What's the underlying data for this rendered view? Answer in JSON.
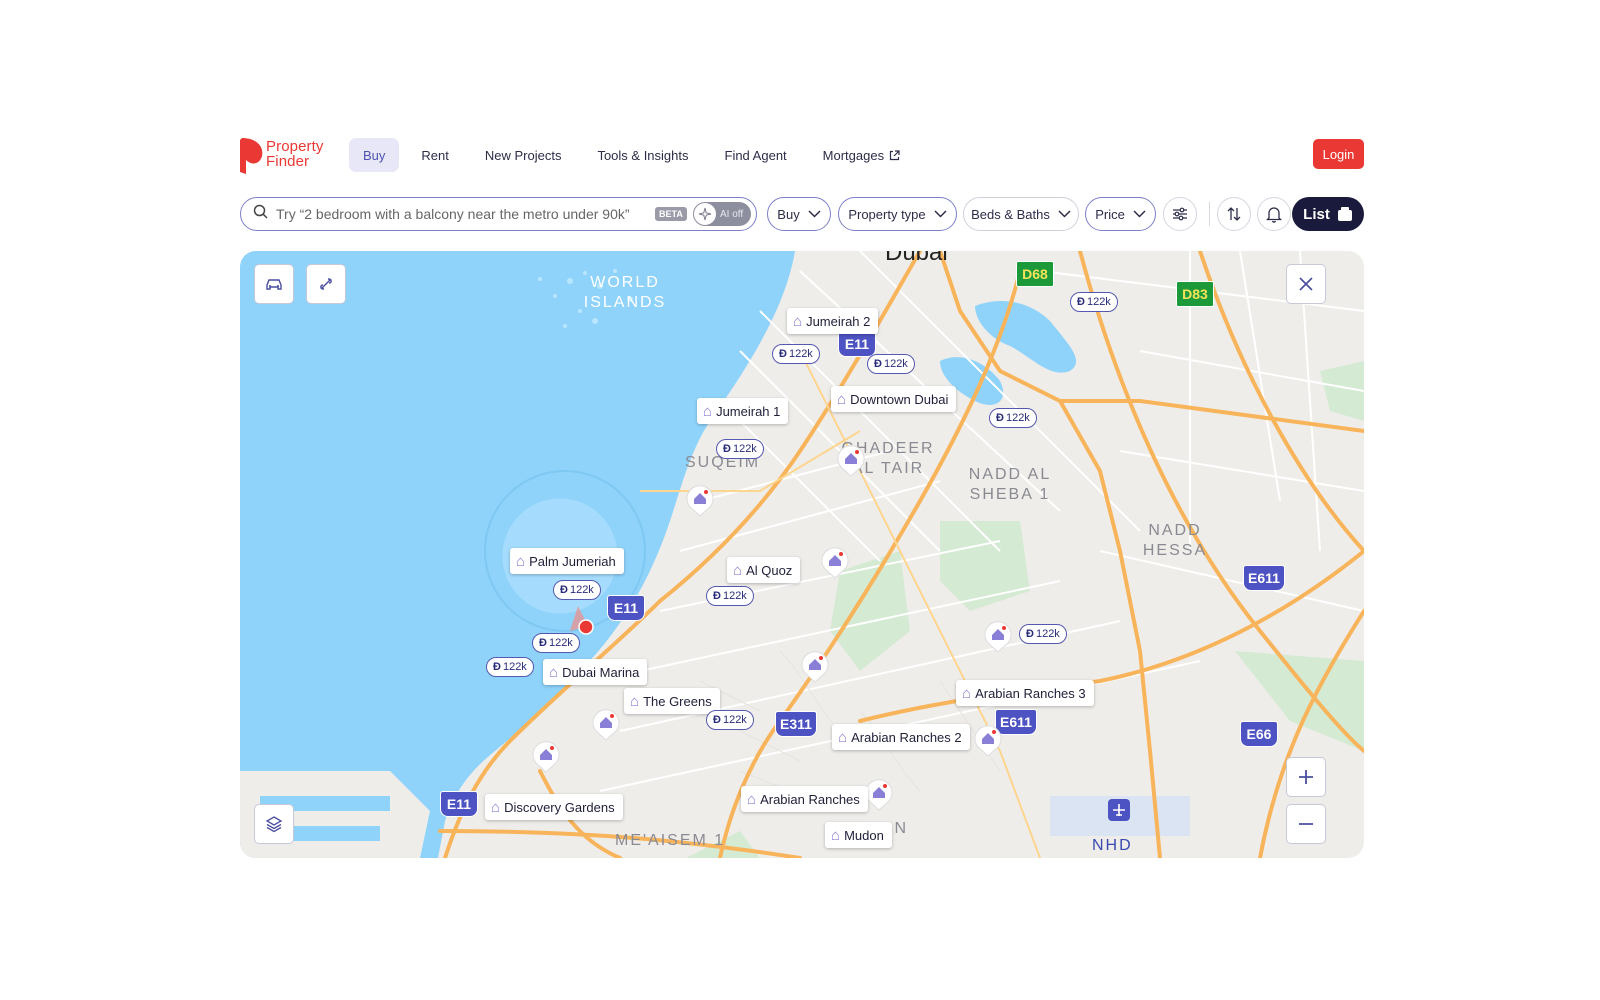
{
  "brand": {
    "name_line1": "Property",
    "name_line2": "Finder",
    "color": "#ea3934"
  },
  "nav": {
    "items": [
      {
        "label": "Buy",
        "active": true
      },
      {
        "label": "Rent"
      },
      {
        "label": "New Projects"
      },
      {
        "label": "Tools & Insights"
      },
      {
        "label": "Find Agent"
      },
      {
        "label": "Mortgages",
        "icon": "external-link-icon"
      }
    ],
    "login_label": "Login"
  },
  "search": {
    "placeholder": "Try “2 bedroom with a balcony near the metro under 90k”",
    "beta_label": "BETA",
    "ai_toggle_label": "AI off"
  },
  "filters": {
    "buy_label": "Buy",
    "property_type_label": "Property type",
    "beds_baths_label": "Beds & Baths",
    "price_label": "Price",
    "list_label": "List"
  },
  "map": {
    "city_label": "Dubai",
    "areas": [
      "WORLD ISLANDS",
      "SUQEIM",
      "GHADEER AL TAIR",
      "NADD AL SHEBA 1",
      "NADD HESSA",
      "ME'AISEM 1",
      "ON",
      "NHD"
    ],
    "roads": [
      "D68",
      "D83",
      "E11",
      "E11",
      "E11",
      "E311",
      "E611",
      "E611",
      "E66"
    ],
    "locations": [
      "Jumeirah 2",
      "Downtown Dubai",
      "Jumeirah 1",
      "Palm Jumeriah",
      "Al Quoz",
      "Dubai Marina",
      "The Greens",
      "Arabian Ranches 3",
      "Arabian Ranches 2",
      "Discovery Gardens",
      "Arabian Ranches",
      "Mudon"
    ],
    "price_pins": [
      "122k",
      "122k",
      "122k",
      "122k",
      "122k",
      "122k",
      "122k",
      "122k",
      "122k",
      "122k",
      "122k",
      "122k"
    ],
    "currency_symbol": "Đ",
    "water_color": "#8fd3fb",
    "land_color": "#efedea"
  }
}
